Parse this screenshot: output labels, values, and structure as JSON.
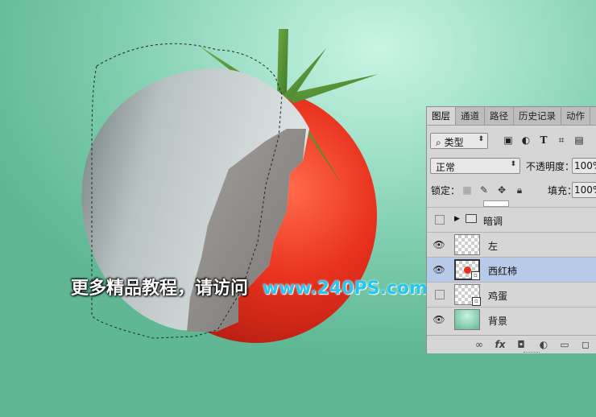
{
  "watermark": {
    "cn_text": "更多精品教程，请访问",
    "url_text": "www.240PS.com"
  },
  "layers_panel": {
    "tabs": [
      {
        "label": "图层",
        "active": true
      },
      {
        "label": "通道",
        "active": false
      },
      {
        "label": "路径",
        "active": false
      },
      {
        "label": "历史记录",
        "active": false
      },
      {
        "label": "动作",
        "active": false
      }
    ],
    "filter": {
      "search_glyph": "⌕",
      "kind_label": "类型",
      "arrow": "⬍"
    },
    "blend_mode": {
      "value": "正常",
      "arrow": "⬍"
    },
    "opacity": {
      "label": "不透明度：",
      "value": "100%"
    },
    "lock": {
      "label": "锁定："
    },
    "fill": {
      "label": "填充：",
      "value": "100%"
    },
    "layers": [
      {
        "name": "暗调",
        "type": "group",
        "visible": false,
        "selected": false
      },
      {
        "name": "左",
        "type": "pixel",
        "visible": true,
        "selected": false
      },
      {
        "name": "西红柿",
        "type": "smart",
        "visible": true,
        "selected": true
      },
      {
        "name": "鸡蛋",
        "type": "smart",
        "visible": false,
        "selected": false
      },
      {
        "name": "背景",
        "type": "background",
        "visible": true,
        "selected": false
      }
    ],
    "bottom_icons": [
      "link-icon",
      "fx-icon",
      "mask-icon",
      "adjustment-icon",
      "folder-icon",
      "new-layer-icon"
    ],
    "fx_label": "fx"
  },
  "colors": {
    "tomato": "#e8321e",
    "selection_highlight": "#b7cbe9",
    "url_blue": "#25c6f0"
  }
}
